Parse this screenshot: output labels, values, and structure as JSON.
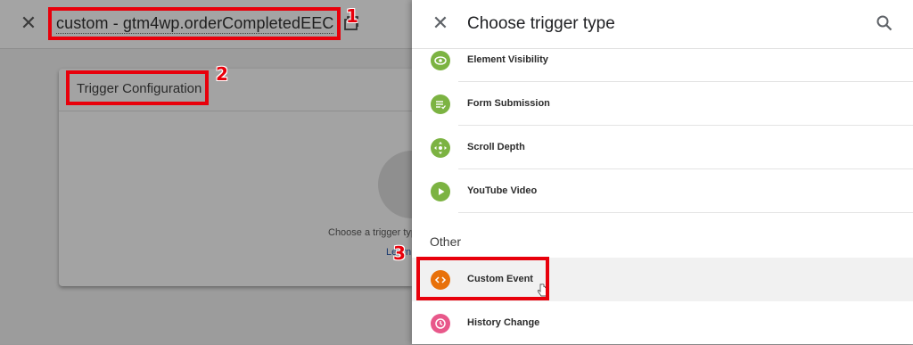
{
  "editor": {
    "trigger_name": "custom - gtm4wp.orderCompletedEEC",
    "config_title": "Trigger Configuration",
    "choose_hint": "Choose a trigger type to begin setup...",
    "learn_link": "Learn More"
  },
  "panel": {
    "title": "Choose trigger type",
    "items": [
      {
        "label": "Element Visibility",
        "icon": "eye-icon",
        "color": "#7cb342"
      },
      {
        "label": "Form Submission",
        "icon": "form-icon",
        "color": "#7cb342"
      },
      {
        "label": "Scroll Depth",
        "icon": "scroll-icon",
        "color": "#7cb342"
      },
      {
        "label": "YouTube Video",
        "icon": "play-icon",
        "color": "#7cb342"
      }
    ],
    "other_section": "Other",
    "other_items": [
      {
        "label": "Custom Event",
        "icon": "code-icon",
        "color": "#e8710a"
      },
      {
        "label": "History Change",
        "icon": "history-icon",
        "color": "#e8588a"
      }
    ]
  },
  "annotations": [
    "1",
    "2",
    "3"
  ],
  "colors": {
    "annotation": "#e8000b",
    "green": "#7cb342",
    "orange": "#e8710a",
    "pink": "#e8588a"
  }
}
